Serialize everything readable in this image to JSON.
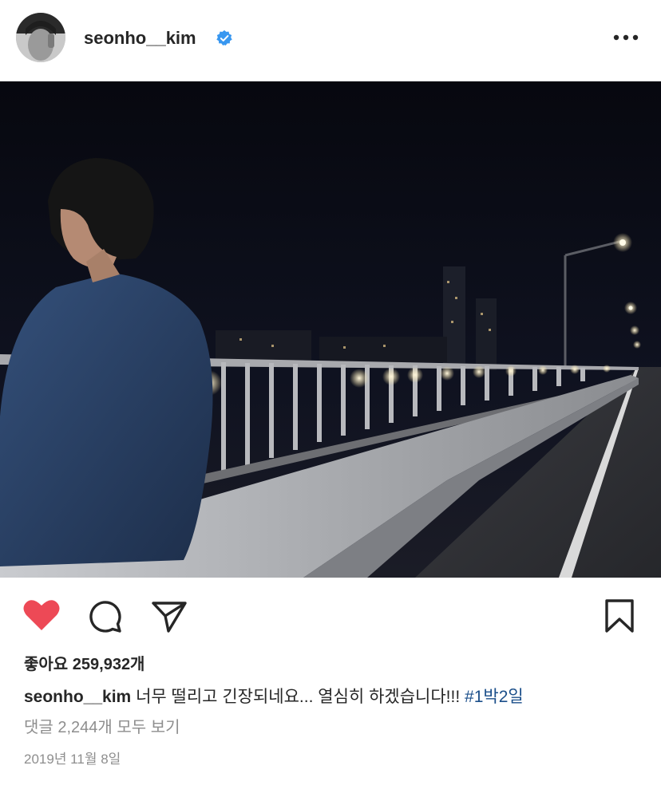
{
  "post": {
    "username": "seonho__kim",
    "verified": true,
    "photo_alt": "",
    "likes_label": "좋아요",
    "likes_count": "259,932개",
    "caption_text": "너무 떨리고 긴장되네요... 열심히 하겠습니다!!!",
    "hashtag": "#1박2일",
    "view_comments": "댓글 2,244개 모두 보기",
    "date": "2019년 11월 8일"
  },
  "colors": {
    "like_red": "#ed4956",
    "verified_blue": "#3897f0",
    "hashtag_blue": "#1b4f8a",
    "muted_gray": "#8e8e8e"
  },
  "icons": {
    "more": "more-horizontal-icon",
    "like": "heart-filled-icon",
    "comment": "comment-bubble-icon",
    "share": "paper-plane-icon",
    "save": "bookmark-icon",
    "verified": "verified-badge-icon"
  }
}
